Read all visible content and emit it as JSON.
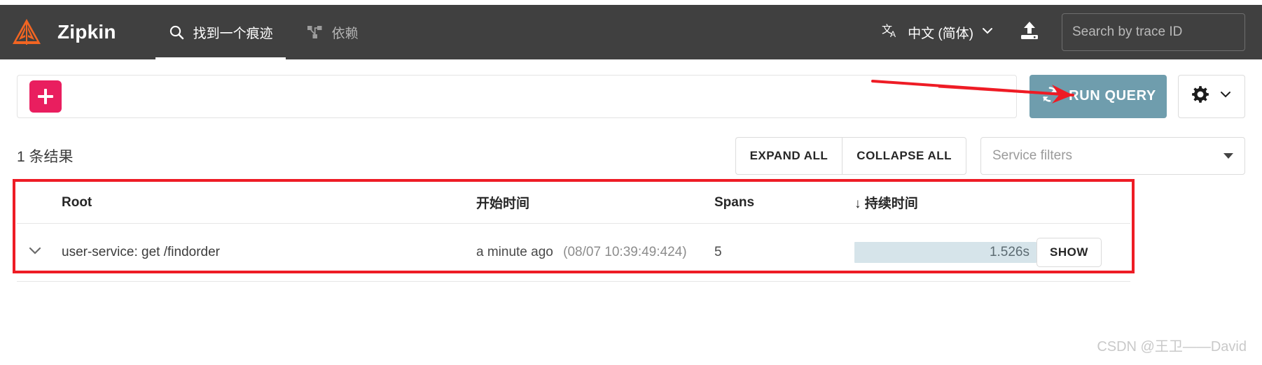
{
  "app": {
    "brand": "Zipkin",
    "logo_color": "#f26522",
    "topbar_bg": "#404040"
  },
  "nav": {
    "tabs": [
      {
        "label": "找到一个痕迹",
        "icon": "search-icon",
        "active": true
      },
      {
        "label": "依赖",
        "icon": "dependency-graph-icon",
        "active": false
      }
    ],
    "language": {
      "icon": "translate-icon",
      "label": "中文 (简体)",
      "chevron": "chevron-down-icon"
    },
    "upload_icon": "upload-icon",
    "trace_search": {
      "placeholder": "Search by trace ID",
      "value": ""
    }
  },
  "query_bar": {
    "add_criteria_label": "+",
    "add_criteria_color": "#e91e5f",
    "run_query_label": "RUN QUERY",
    "run_query_icon": "refresh-icon",
    "run_query_color": "#6f9dad",
    "settings_icon": "gear-icon",
    "settings_chevron": "chevron-down-icon"
  },
  "results_toolbar": {
    "count_text": "1 条结果",
    "expand_all_label": "EXPAND ALL",
    "collapse_all_label": "COLLAPSE ALL",
    "service_filters_placeholder": "Service filters",
    "service_filters_value": ""
  },
  "table": {
    "columns": {
      "caret": "",
      "root": "Root",
      "start_time": "开始时间",
      "spans": "Spans",
      "duration": "持续时间",
      "duration_sort_arrow": "↓",
      "show": ""
    },
    "rows": [
      {
        "caret_icon": "chevron-down-icon",
        "root": "user-service: get /findorder",
        "start_relative": "a minute ago",
        "start_absolute": "(08/07 10:39:49:424)",
        "spans": "5",
        "duration": "1.526s",
        "duration_bar_pct": 100,
        "duration_bar_color": "#d6e4ea",
        "show_label": "SHOW"
      }
    ]
  },
  "annotations": {
    "highlight_color": "#ee1c25",
    "rect_label": "results-table-highlight",
    "arrow_label": "arrow-to-run-query"
  },
  "watermark": "CSDN @王卫——David"
}
